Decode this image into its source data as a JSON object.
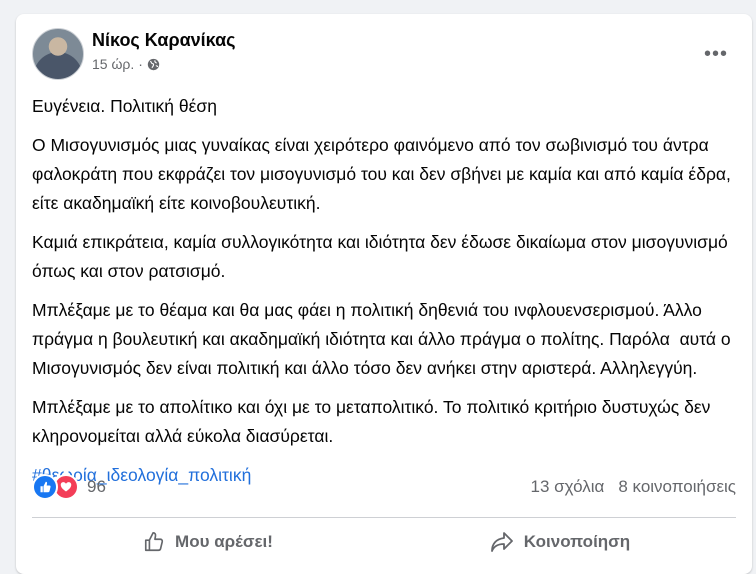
{
  "post": {
    "author": "Νίκος Καρανίκας",
    "time": "15 ώρ.",
    "separator": "·",
    "more_label": "•••",
    "paragraphs": [
      "Ευγένεια. Πολιτική θέση",
      "Ο Μισογυνισμός μιας γυναίκας είναι χειρότερο φαινόμενο από τον σωβινισμό του άντρα φαλοκράτη που εκφράζει τον μισογυνισμό του και δεν σβήνει με καμία και από καμία έδρα, είτε ακαδημαϊκή είτε κοινοβουλευτική.",
      "Καμιά επικράτεια, καμία συλλογικότητα και ιδιότητα δεν έδωσε δικαίωμα στον μισογυνισμό όπως και στον ρατσισμό.",
      "Μπλέξαμε με το θέαμα και θα μας φάει η πολιτική δηθενιά του ινφλουενσερισμού. Άλλο πράγμα η βουλευτική και ακαδημαϊκή ιδιότητα και άλλο πράγμα ο πολίτης. Παρόλα  αυτά ο Μισογυνισμός δεν είναι πολιτική και άλλο τόσο δεν ανήκει στην αριστερά. Αλληλεγγύη.",
      "Μπλέξαμε με το απολίτικο και όχι με το μεταπολιτικό. Το πολιτικό κριτήριο δυστυχώς δεν κληρονομείται αλλά εύκολα διασύρεται."
    ],
    "hashtag": "#θεωρία_ιδεολογία_πολιτική"
  },
  "stats": {
    "reactions_count": "96",
    "comments": "13 σχόλια",
    "shares": "8 κοινοποιήσεις"
  },
  "actions": {
    "like_label": "Μου αρέσει!",
    "share_label": "Κοινοποίηση"
  },
  "colors": {
    "like": "#1877f2",
    "love": "#f33e58",
    "link": "#216fdb"
  }
}
